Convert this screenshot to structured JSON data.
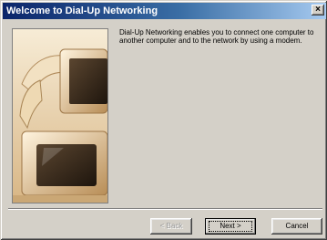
{
  "window": {
    "title": "Welcome to Dial-Up Networking",
    "close_label": "×"
  },
  "content": {
    "message": "Dial-Up Networking enables you to connect one computer to another computer and to the network by using a modem."
  },
  "buttons": {
    "back_label": "< Back",
    "next_label": "Next >",
    "cancel_label": "Cancel"
  },
  "colors": {
    "title_start": "#0a246a",
    "title_end": "#a6caf0",
    "face": "#d4d0c8"
  }
}
